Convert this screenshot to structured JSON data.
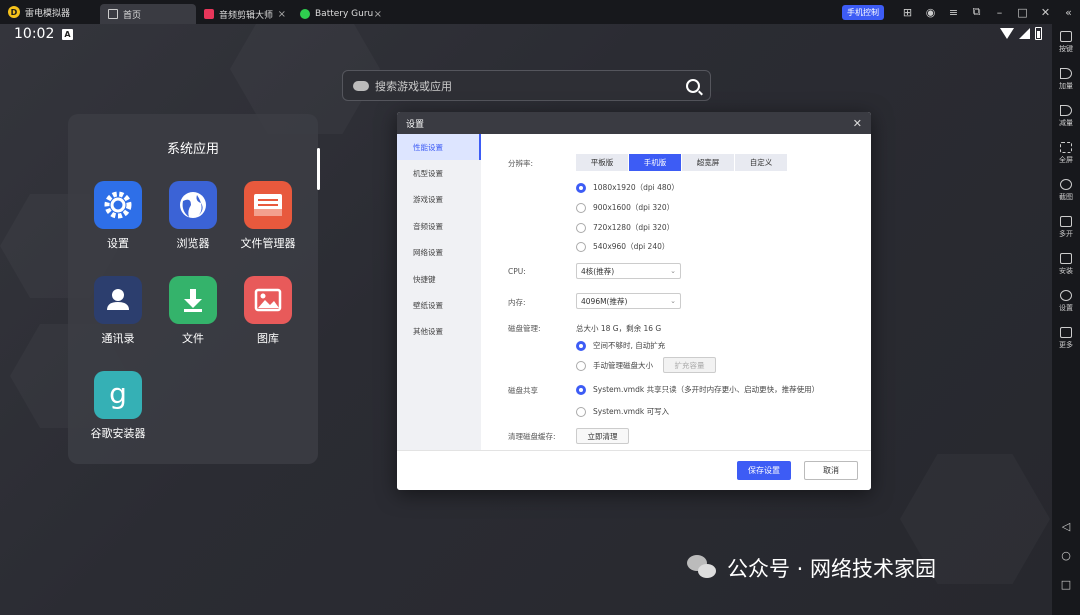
{
  "titlebar": {
    "app_name": "雷电模拟器",
    "tabs": [
      {
        "label": "首页",
        "icon": "home-icon"
      },
      {
        "label": "音频剪辑大师",
        "icon": "audio-app-icon"
      },
      {
        "label": "Battery Guru",
        "icon": "battery-app-icon"
      }
    ],
    "phone_control": "手机控制"
  },
  "status": {
    "time": "10:02",
    "badge": "A"
  },
  "search": {
    "placeholder": "搜索游戏或应用"
  },
  "apps_panel": {
    "title": "系统应用",
    "apps": [
      {
        "label": "设置",
        "icon": "settings-icon",
        "color": "#2e6fe8"
      },
      {
        "label": "浏览器",
        "icon": "browser-icon",
        "color": "#3b63d6"
      },
      {
        "label": "文件管理器",
        "icon": "file-manager-icon",
        "color": "#e8593d"
      },
      {
        "label": "通讯录",
        "icon": "contacts-icon",
        "color": "#2c3e6e"
      },
      {
        "label": "文件",
        "icon": "download-icon",
        "color": "#34b36b"
      },
      {
        "label": "图库",
        "icon": "gallery-icon",
        "color": "#e85a5a"
      },
      {
        "label": "谷歌安装器",
        "icon": "google-installer-icon",
        "color": "#35b0b5"
      }
    ]
  },
  "sidebar": {
    "items": [
      {
        "label": "按键"
      },
      {
        "label": "加量"
      },
      {
        "label": "减量"
      },
      {
        "label": "全屏"
      },
      {
        "label": "截图"
      },
      {
        "label": "多开"
      },
      {
        "label": "安装"
      },
      {
        "label": "设置"
      },
      {
        "label": "更多"
      }
    ]
  },
  "dialog": {
    "title": "设置",
    "nav": [
      "性能设置",
      "机型设置",
      "游戏设置",
      "音频设置",
      "网络设置",
      "快捷键",
      "壁纸设置",
      "其他设置"
    ],
    "resolution_label": "分辨率:",
    "segments": [
      "平板版",
      "手机版",
      "超宽屏",
      "自定义"
    ],
    "resolutions": [
      "1080x1920（dpi 480）",
      "900x1600（dpi 320）",
      "720x1280（dpi 320）",
      "540x960（dpi 240）"
    ],
    "cpu_label": "CPU:",
    "cpu_value": "4核(推荐)",
    "memory_label": "内存:",
    "memory_value": "4096M(推荐)",
    "disk_label": "磁盘管理:",
    "disk_info": "总大小 18 G，剩余 16 G",
    "disk_auto": "空间不够时, 自动扩充",
    "disk_manual": "手动管理磁盘大小",
    "expand_button": "扩充容量",
    "share_label": "磁盘共享",
    "share_readonly": "System.vmdk 共享只读（多开时内存更小、启动更快，推荐使用）",
    "share_writable": "System.vmdk 可写入",
    "cache_label": "清理磁盘缓存:",
    "cache_button": "立即清理",
    "save": "保存设置",
    "cancel": "取消"
  },
  "watermark": {
    "text": "公众号 · 网络技术家园"
  }
}
